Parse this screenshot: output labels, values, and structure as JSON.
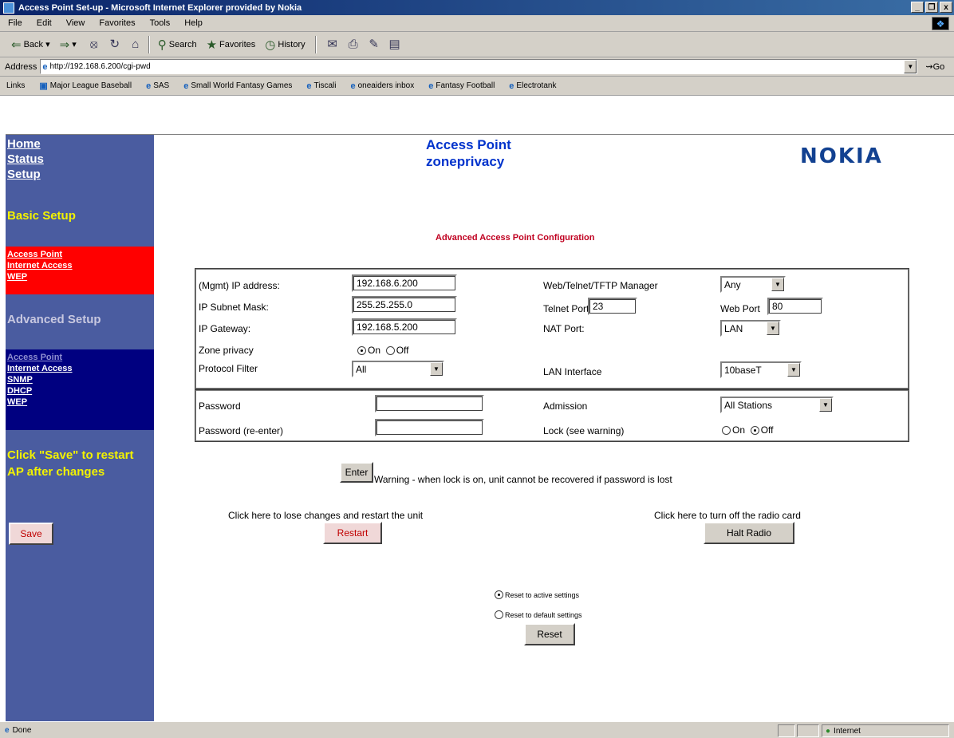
{
  "window": {
    "title": "Access Point Set-up - Microsoft Internet Explorer provided by Nokia",
    "controls": [
      "_",
      "❒",
      "x"
    ]
  },
  "menu": [
    "File",
    "Edit",
    "View",
    "Favorites",
    "Tools",
    "Help"
  ],
  "toolbar": {
    "back": "Back",
    "search": "Search",
    "favorites": "Favorites",
    "history": "History"
  },
  "address": {
    "label": "Address",
    "url": "http://192.168.6.200/cgi-pwd",
    "go": "Go"
  },
  "links": {
    "label": "Links",
    "items": [
      "Major League Baseball",
      "SAS",
      "Small World Fantasy Games",
      "Tiscali",
      "oneaiders inbox",
      "Fantasy Football",
      "Electrotank"
    ]
  },
  "sidebar": {
    "nav": [
      "Home",
      "Status",
      "Setup"
    ],
    "basic_title": "Basic Setup",
    "basic_items": [
      "Access Point",
      "Internet Access",
      "WEP"
    ],
    "advanced_title": "Advanced Setup",
    "advanced_items": [
      "Access Point",
      "Internet Access",
      "SNMP",
      "DHCP",
      "WEP"
    ],
    "save_note": "Click \"Save\" to restart AP after changes",
    "save_label": "Save"
  },
  "header": {
    "title_line1": "Access Point",
    "title_line2": "zoneprivacy",
    "logo": "NOKIA"
  },
  "config": {
    "heading": "Advanced Access Point Configuration",
    "mgmt_ip_label": "(Mgmt) IP address:",
    "mgmt_ip": "192.168.6.200",
    "subnet_label": "IP Subnet Mask:",
    "subnet": "255.25.255.0",
    "gateway_label": "IP Gateway:",
    "gateway": "192.168.5.200",
    "zone_label": "Zone privacy",
    "zone_on": "On",
    "zone_off": "Off",
    "protocol_label": "Protocol Filter",
    "protocol": "All",
    "manager_label": "Web/Telnet/TFTP Manager",
    "manager": "Any",
    "telnet_label": "Telnet Port",
    "telnet_port": "23",
    "web_label": "Web Port",
    "web_port": "80",
    "nat_label": "NAT Port:",
    "nat": "LAN",
    "lan_label": "LAN Interface",
    "lan": "10baseT",
    "password_label": "Password",
    "password_reenter_label": "Password (re-enter)",
    "admission_label": "Admission",
    "admission": "All Stations",
    "lock_label": "Lock (see warning)",
    "lock_on": "On",
    "lock_off": "Off"
  },
  "actions": {
    "enter_label": "Enter",
    "warning": "Warning - when lock is on, unit cannot be recovered if password is lost",
    "restart_note": "Click here to lose changes and restart the unit",
    "restart_label": "Restart",
    "halt_note": "Click here to turn off the radio card",
    "halt_label": "Halt Radio",
    "reset_active": "Reset to active settings",
    "reset_default": "Reset to default settings",
    "reset_label": "Reset"
  },
  "status": {
    "text": "Done",
    "zone": "Internet"
  }
}
